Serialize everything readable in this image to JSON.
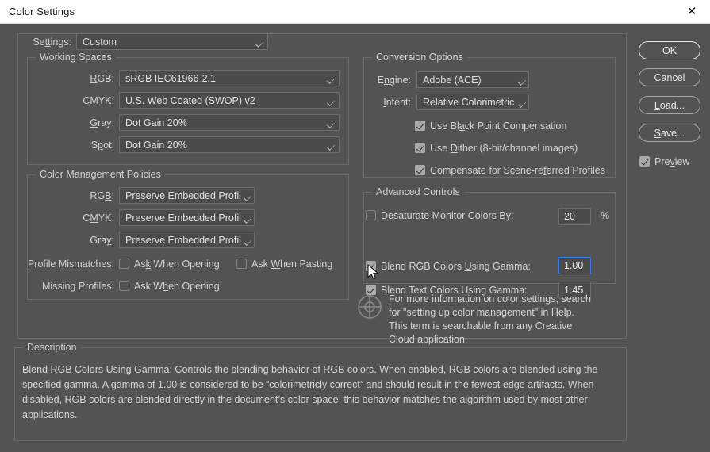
{
  "window": {
    "title": "Color Settings",
    "close_icon": "close-icon"
  },
  "settings_row": {
    "label": "Settings:",
    "label_accel": "tt",
    "value": "Custom"
  },
  "working_spaces": {
    "legend": "Working Spaces",
    "rows": [
      {
        "label": "RGB:",
        "value": "sRGB IEC61966-2.1"
      },
      {
        "label": "CMYK:",
        "value": "U.S. Web Coated (SWOP) v2"
      },
      {
        "label": "Gray:",
        "value": "Dot Gain 20%"
      },
      {
        "label": "Spot:",
        "value": "Dot Gain 20%"
      }
    ]
  },
  "color_management_policies": {
    "legend": "Color Management Policies",
    "rows": [
      {
        "label": "RGB:",
        "value": "Preserve Embedded Profiles"
      },
      {
        "label": "CMYK:",
        "value": "Preserve Embedded Profiles"
      },
      {
        "label": "Gray:",
        "value": "Preserve Embedded Profiles"
      }
    ],
    "profile_mismatches_label": "Profile Mismatches:",
    "missing_profiles_label": "Missing Profiles:",
    "ask_when_opening_1": "Ask When Opening",
    "ask_when_pasting": "Ask When Pasting",
    "ask_when_opening_2": "Ask When Opening",
    "ask_when_opening_1_checked": false,
    "ask_when_pasting_checked": false,
    "ask_when_opening_2_checked": false
  },
  "conversion_options": {
    "legend": "Conversion Options",
    "engine_label": "Engine:",
    "engine_value": "Adobe (ACE)",
    "intent_label": "Intent:",
    "intent_value": "Relative Colorimetric",
    "checks": [
      {
        "label": "Use Black Point Compensation",
        "checked": true
      },
      {
        "label": "Use Dither (8-bit/channel images)",
        "checked": true
      },
      {
        "label": "Compensate for Scene-referred Profiles",
        "checked": true
      }
    ]
  },
  "advanced_controls": {
    "legend": "Advanced Controls",
    "rows": [
      {
        "label": "Desaturate Monitor Colors By:",
        "checked": false,
        "value": "20",
        "unit": "%",
        "focused": false
      },
      {
        "label": "Blend RGB Colors Using Gamma:",
        "checked": true,
        "value": "1.00",
        "unit": "",
        "focused": true
      },
      {
        "label": "Blend Text Colors Using Gamma:",
        "checked": true,
        "value": "1.45",
        "unit": "",
        "focused": false
      }
    ]
  },
  "help_note": {
    "icon": "color-wheel-icon",
    "text": "For more information on color settings, search for \"setting up color management\" in Help. This term is searchable from any Creative Cloud application."
  },
  "description": {
    "legend": "Description",
    "text": "Blend RGB Colors Using Gamma:  Controls the blending behavior of RGB colors.  When enabled, RGB colors are blended using the specified gamma.  A gamma of 1.00 is considered to be “colorimetricly correct” and should result in the fewest edge artifacts.  When disabled, RGB colors are blended directly in the document’s color space; this behavior matches the algorithm used by most other applications."
  },
  "buttons": {
    "ok": "OK",
    "cancel": "Cancel",
    "load": "Load...",
    "save": "Save...",
    "preview_label": "Preview",
    "preview_checked": true
  },
  "colors": {
    "dialog_bg": "#535353",
    "titlebar_bg": "#ffffff",
    "field_bg": "#4b4b4b",
    "border": "#6a6a6a",
    "text": "#d2d2d2",
    "focus_blue": "#3a7ce0"
  }
}
